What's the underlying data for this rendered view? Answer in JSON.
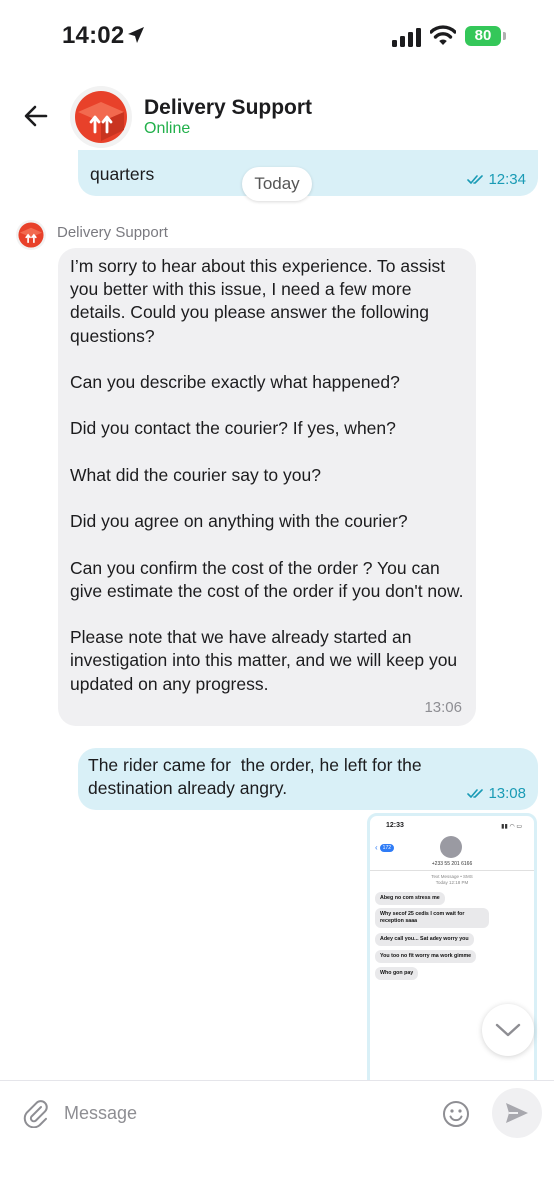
{
  "status_bar": {
    "time": "14:02",
    "battery": "80"
  },
  "header": {
    "title": "Delivery Support",
    "status": "Online"
  },
  "chat": {
    "date_divider": "Today",
    "messages": [
      {
        "direction": "out",
        "text": "quarters",
        "time": "12:34"
      },
      {
        "direction": "in",
        "sender": "Delivery Support",
        "text": "I’m sorry to hear about this experience. To assist you better with this issue, I need a few more details. Could you please answer the following questions?\n\nCan you describe exactly what happened?\n\nDid you contact the courier? If yes, when?\n\nWhat did the courier say to you?\n\nDid you agree on anything with the courier?\n\nCan you confirm the cost of the order ? You can give estimate the cost of the order if you don't now.\n\nPlease note that we have already started an investigation into this matter, and we will keep you updated on any progress.",
        "time": "13:06"
      },
      {
        "direction": "out",
        "text": "The rider came for  the order, he left for the destination already angry.",
        "time": "13:08"
      }
    ],
    "attachment": {
      "time": "12:33",
      "back_badge": "172",
      "phone": "+233 55 201 6166",
      "meta_line1": "Text Message • SMS",
      "meta_line2": "Today 12:18 PM",
      "sms": [
        "Abeg no com stress me",
        "Why secof 25 cedis I com wait for reception saaa",
        "Adey call you... Sat adey worry you",
        "You too no fit worry ma work gimme",
        "Who gon pay"
      ]
    }
  },
  "composer": {
    "placeholder": "Message"
  },
  "colors": {
    "outgoing_bubble": "#d9f0f7",
    "incoming_bubble": "#f0f0f2",
    "online_green": "#22b04b",
    "time_teal": "#1a9bb5",
    "brand_red": "#e8412a"
  },
  "icons": [
    "location-arrow-icon",
    "signal-icon",
    "wifi-icon",
    "back-arrow-icon",
    "delivery-box-logo",
    "double-check-icon",
    "chevron-down-icon",
    "paperclip-icon",
    "emoji-icon",
    "send-icon"
  ]
}
